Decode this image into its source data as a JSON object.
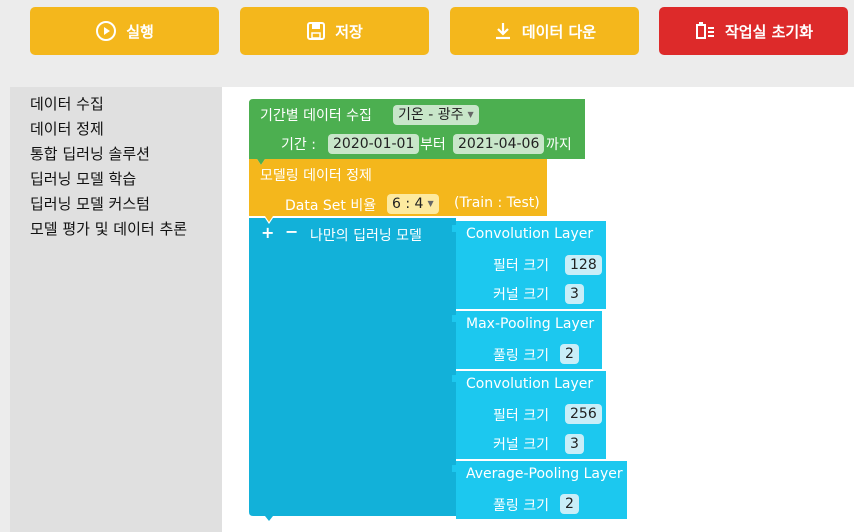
{
  "toolbar": {
    "run_label": "실행",
    "save_label": "저장",
    "download_label": "데이터 다운",
    "reset_label": "작업실 초기화",
    "colors": {
      "primary": "#f4b71c",
      "danger": "#dd2a2a"
    }
  },
  "sidebar": {
    "categories": [
      "데이터 수집",
      "데이터 정제",
      "통합 딥러닝 솔루션",
      "딥러닝 모델 학습",
      "딥러닝 모델 커스텀",
      "모델 평가 및 데이터 추론"
    ]
  },
  "blocks": {
    "collect": {
      "title": "기간별 데이터 수집",
      "source": "기온 - 광주",
      "period_label": "기간 :",
      "start_date": "2020-01-01",
      "from_label": "부터",
      "end_date": "2021-04-06",
      "to_label": "까지",
      "color": "#4caf50"
    },
    "refine": {
      "title": "모델링 데이터 정제",
      "ratio_label": "Data Set 비율",
      "ratio": "6 : 4",
      "ratio_note": "(Train : Test)",
      "color": "#f4b71c"
    },
    "model": {
      "plus": "+",
      "minus": "−",
      "title": "나만의 딥러닝 모델",
      "color": "#12b1d9",
      "layer_color": "#1cc8ef",
      "layers": [
        {
          "name": "Convolution Layer",
          "params": [
            {
              "label": "필터 크기",
              "value": "128"
            },
            {
              "label": "커널 크기",
              "value": "3"
            }
          ]
        },
        {
          "name": "Max-Pooling Layer",
          "params": [
            {
              "label": "풀링 크기",
              "value": "2"
            }
          ]
        },
        {
          "name": "Convolution Layer",
          "params": [
            {
              "label": "필터 크기",
              "value": "256"
            },
            {
              "label": "커널 크기",
              "value": "3"
            }
          ]
        },
        {
          "name": "Average-Pooling Layer",
          "params": [
            {
              "label": "풀링 크기",
              "value": "2"
            }
          ]
        }
      ]
    }
  }
}
